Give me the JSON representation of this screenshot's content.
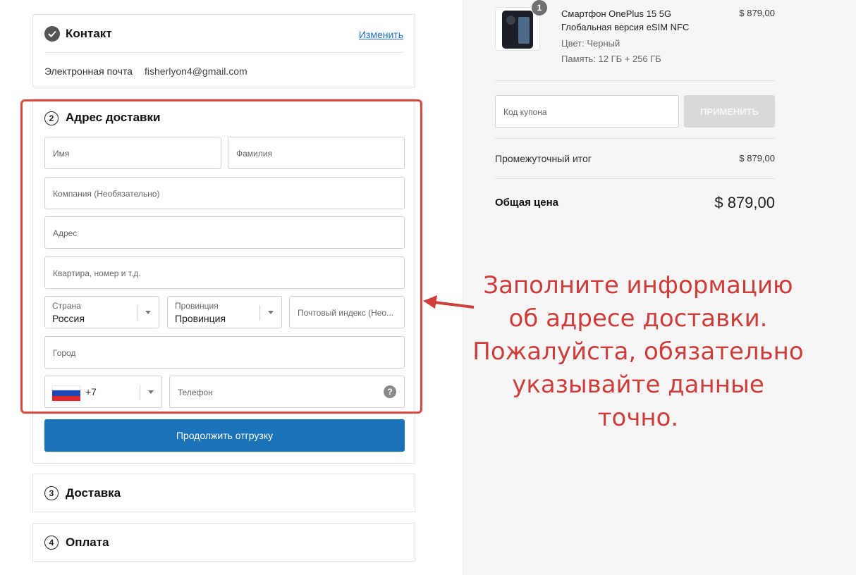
{
  "contact": {
    "title": "Контакт",
    "edit_label": "Изменить",
    "email_label": "Электронная почта",
    "email_value": "fisherlyon4@gmail.com"
  },
  "shipping": {
    "step_number": "2",
    "title": "Адрес доставки",
    "first_name_placeholder": "Имя",
    "last_name_placeholder": "Фамилия",
    "company_placeholder": "Компания (Необязательно)",
    "address_placeholder": "Адрес",
    "apartment_placeholder": "Квартира, номер и т.д.",
    "country_label": "Страна",
    "country_value": "Россия",
    "province_label": "Провинция",
    "province_value": "Провинция",
    "postal_placeholder": "Почтовый индекс (Нео...",
    "city_placeholder": "Город",
    "phone_code": "+7",
    "phone_placeholder": "Телефон",
    "help_symbol": "?",
    "continue_label": "Продолжить отгрузку"
  },
  "delivery": {
    "step_number": "3",
    "title": "Доставка"
  },
  "payment": {
    "step_number": "4",
    "title": "Оплата"
  },
  "order": {
    "quantity": "1",
    "product_title_line1": "Смартфон OnePlus 15 5G",
    "product_title_line2": "Глобальная версия eSIM NFC",
    "product_price": "$ 879,00",
    "color_option": "Цвет: Черный",
    "memory_option": "Память: 12 ГБ + 256 ГБ",
    "coupon_placeholder": "Код купона",
    "apply_label": "ПРИМЕНИТЬ",
    "subtotal_label": "Промежуточный итог",
    "subtotal_value": "$ 879,00",
    "total_label": "Общая цена",
    "total_value": "$ 879,00"
  },
  "annotation": {
    "line1": "Заполните информацию",
    "line2": "об адресе доставки.",
    "line3": "Пожалуйста, обязательно",
    "line4": "указывайте данные точно."
  },
  "colors": {
    "accent": "#1a73b8",
    "highlight": "#d64a3f",
    "annotation_text": "#cf3d3a"
  },
  "icons": [
    "check-icon",
    "step-number-icon",
    "chevron-down-icon",
    "russia-flag-icon",
    "help-icon",
    "arrow-left-icon"
  ]
}
